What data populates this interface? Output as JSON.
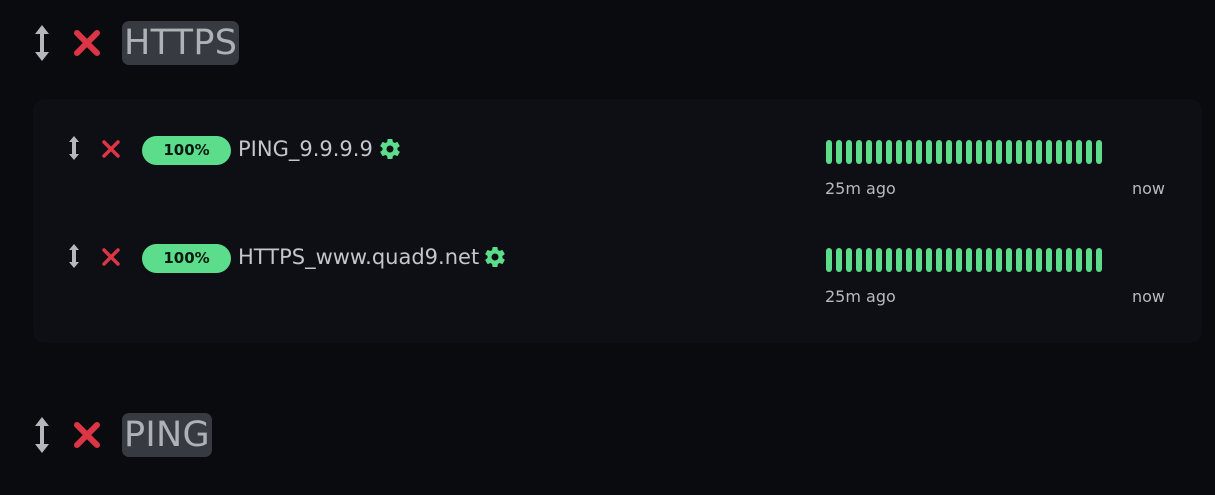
{
  "groups": [
    {
      "title": "HTTPS",
      "monitors": [
        {
          "name": "PING_9.9.9.9",
          "uptime": "100%",
          "time_start": "25m ago",
          "time_end": "now",
          "beats": 28,
          "beat_status": "up"
        },
        {
          "name": "HTTPS_www.quad9.net",
          "uptime": "100%",
          "time_start": "25m ago",
          "time_end": "now",
          "beats": 28,
          "beat_status": "up"
        }
      ]
    },
    {
      "title": "PING",
      "monitors": []
    }
  ],
  "colors": {
    "up": "#5cdd8b",
    "delete": "#dc3545",
    "background": "#090b0e",
    "panel": "#0d0f15",
    "group_title_bg": "#373a40"
  },
  "icons": [
    "drag-handle-icon",
    "close-icon",
    "gear-icon"
  ]
}
